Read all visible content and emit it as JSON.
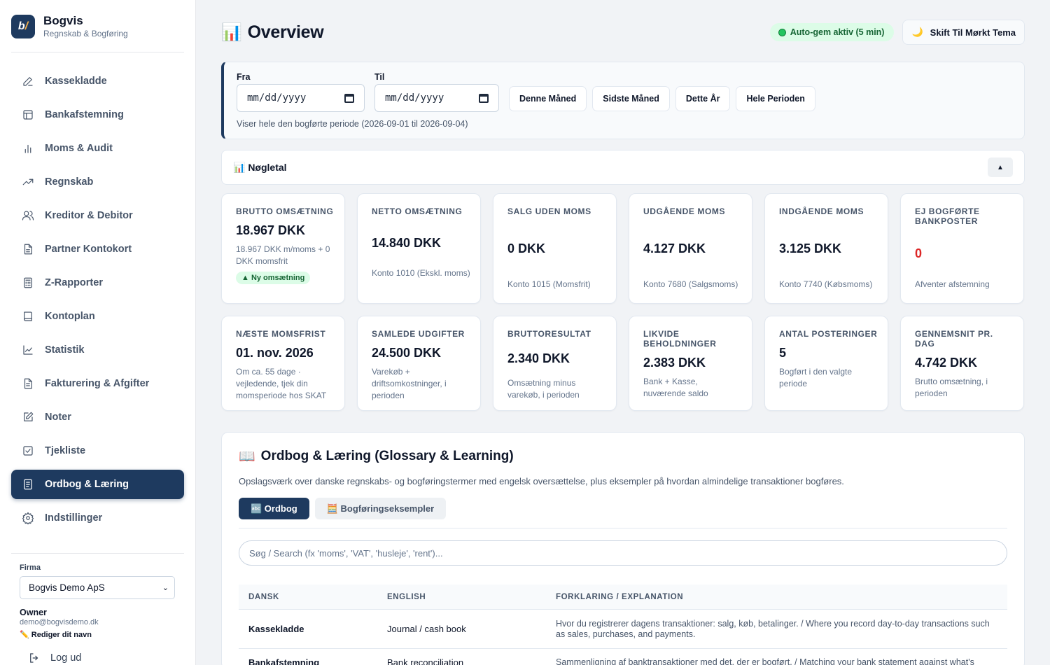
{
  "brand": {
    "name": "Bogvis",
    "subtitle": "Regnskab & Bogføring"
  },
  "sidebar": {
    "items": [
      {
        "label": "Kassekladde",
        "icon": "pencil-icon"
      },
      {
        "label": "Bankafstemning",
        "icon": "bank-icon"
      },
      {
        "label": "Moms & Audit",
        "icon": "bar-chart-icon"
      },
      {
        "label": "Regnskab",
        "icon": "trend-icon"
      },
      {
        "label": "Kreditor & Debitor",
        "icon": "users-icon"
      },
      {
        "label": "Partner Kontokort",
        "icon": "document-icon"
      },
      {
        "label": "Z-Rapporter",
        "icon": "calculator-icon"
      },
      {
        "label": "Kontoplan",
        "icon": "book-icon"
      },
      {
        "label": "Statistik",
        "icon": "line-chart-icon"
      },
      {
        "label": "Fakturering & Afgifter",
        "icon": "invoice-icon"
      },
      {
        "label": "Noter",
        "icon": "note-icon"
      },
      {
        "label": "Tjekliste",
        "icon": "checklist-icon"
      },
      {
        "label": "Ordbog & Læring",
        "icon": "glossary-icon",
        "active": true
      },
      {
        "label": "Indstillinger",
        "icon": "gear-icon"
      }
    ],
    "firm_label": "Firma",
    "firm_value": "Bogvis Demo ApS",
    "owner_role": "Owner",
    "owner_email": "demo@bogvisdemo.dk",
    "edit_name": "✏️ Rediger dit navn",
    "logout": "Log ud"
  },
  "header": {
    "title": "Overview",
    "autosave": "Auto-gem aktiv (5 min)",
    "theme_toggle": "Skift Til Mørkt Tema"
  },
  "period": {
    "from_label": "Fra",
    "to_label": "Til",
    "from_placeholder": "mm/dd/yyyy",
    "to_placeholder": "mm/dd/yyyy",
    "buttons": [
      "Denne Måned",
      "Sidste Måned",
      "Dette År",
      "Hele Perioden"
    ],
    "note": "Viser hele den bogførte periode (2026-09-01 til 2026-09-04)"
  },
  "kpi": {
    "title": "📊 Nøgletal",
    "collapse": "▲",
    "row1": [
      {
        "label": "Brutto omsætning",
        "value": "18.967 DKK",
        "sub": "18.967 DKK m/moms + 0 DKK momsfrit",
        "badge": "▲ Ny omsætning"
      },
      {
        "label": "Netto omsætning",
        "value": "14.840 DKK",
        "sub": "Konto 1010 (Ekskl. moms)"
      },
      {
        "label": "Salg uden moms",
        "value": "0 DKK",
        "sub": "Konto 1015 (Momsfrit)"
      },
      {
        "label": "Udgående moms",
        "value": "4.127 DKK",
        "sub": "Konto 7680 (Salgsmoms)"
      },
      {
        "label": "Indgående moms",
        "value": "3.125 DKK",
        "sub": "Konto 7740 (Købsmoms)"
      },
      {
        "label": "Ej bogførte bankposter",
        "value": "0",
        "sub": "Afventer afstemning",
        "red": true
      }
    ],
    "row2": [
      {
        "label": "Næste momsfrist",
        "value": "01. nov. 2026",
        "sub": "Om ca. 55 dage · vejledende, tjek din momsperiode hos SKAT"
      },
      {
        "label": "Samlede udgifter",
        "value": "24.500 DKK",
        "sub": "Varekøb + driftsomkostninger, i perioden"
      },
      {
        "label": "Bruttoresultat",
        "value": "2.340 DKK",
        "sub": "Omsætning minus varekøb, i perioden"
      },
      {
        "label": "Likvide beholdninger",
        "value": "2.383 DKK",
        "sub": "Bank + Kasse, nuværende saldo"
      },
      {
        "label": "Antal posteringer",
        "value": "5",
        "sub": "Bogført i den valgte periode"
      },
      {
        "label": "Gennemsnit pr. dag",
        "value": "4.742 DKK",
        "sub": "Brutto omsætning, i perioden"
      }
    ]
  },
  "glossary": {
    "title": "Ordbog & Læring (Glossary & Learning)",
    "description": "Opslagsværk over danske regnskabs- og bogføringstermer med engelsk oversættelse, plus eksempler på hvordan almindelige transaktioner bogføres.",
    "tabs": [
      "🔤 Ordbog",
      "🧮 Bogføringseksempler"
    ],
    "search_placeholder": "Søg / Search (fx 'moms', 'VAT', 'husleje', 'rent')...",
    "columns": [
      "Dansk",
      "English",
      "Forklaring / Explanation"
    ],
    "rows": [
      [
        "Kassekladde",
        "Journal / cash book",
        "Hvor du registrerer dagens transaktioner: salg, køb, betalinger. / Where you record day-to-day transactions such as sales, purchases, and payments."
      ],
      [
        "Bankafstemning",
        "Bank reconciliation",
        "Sammenligning af banktransaktioner med det, der er bogført. / Matching your bank statement against what's"
      ]
    ]
  }
}
